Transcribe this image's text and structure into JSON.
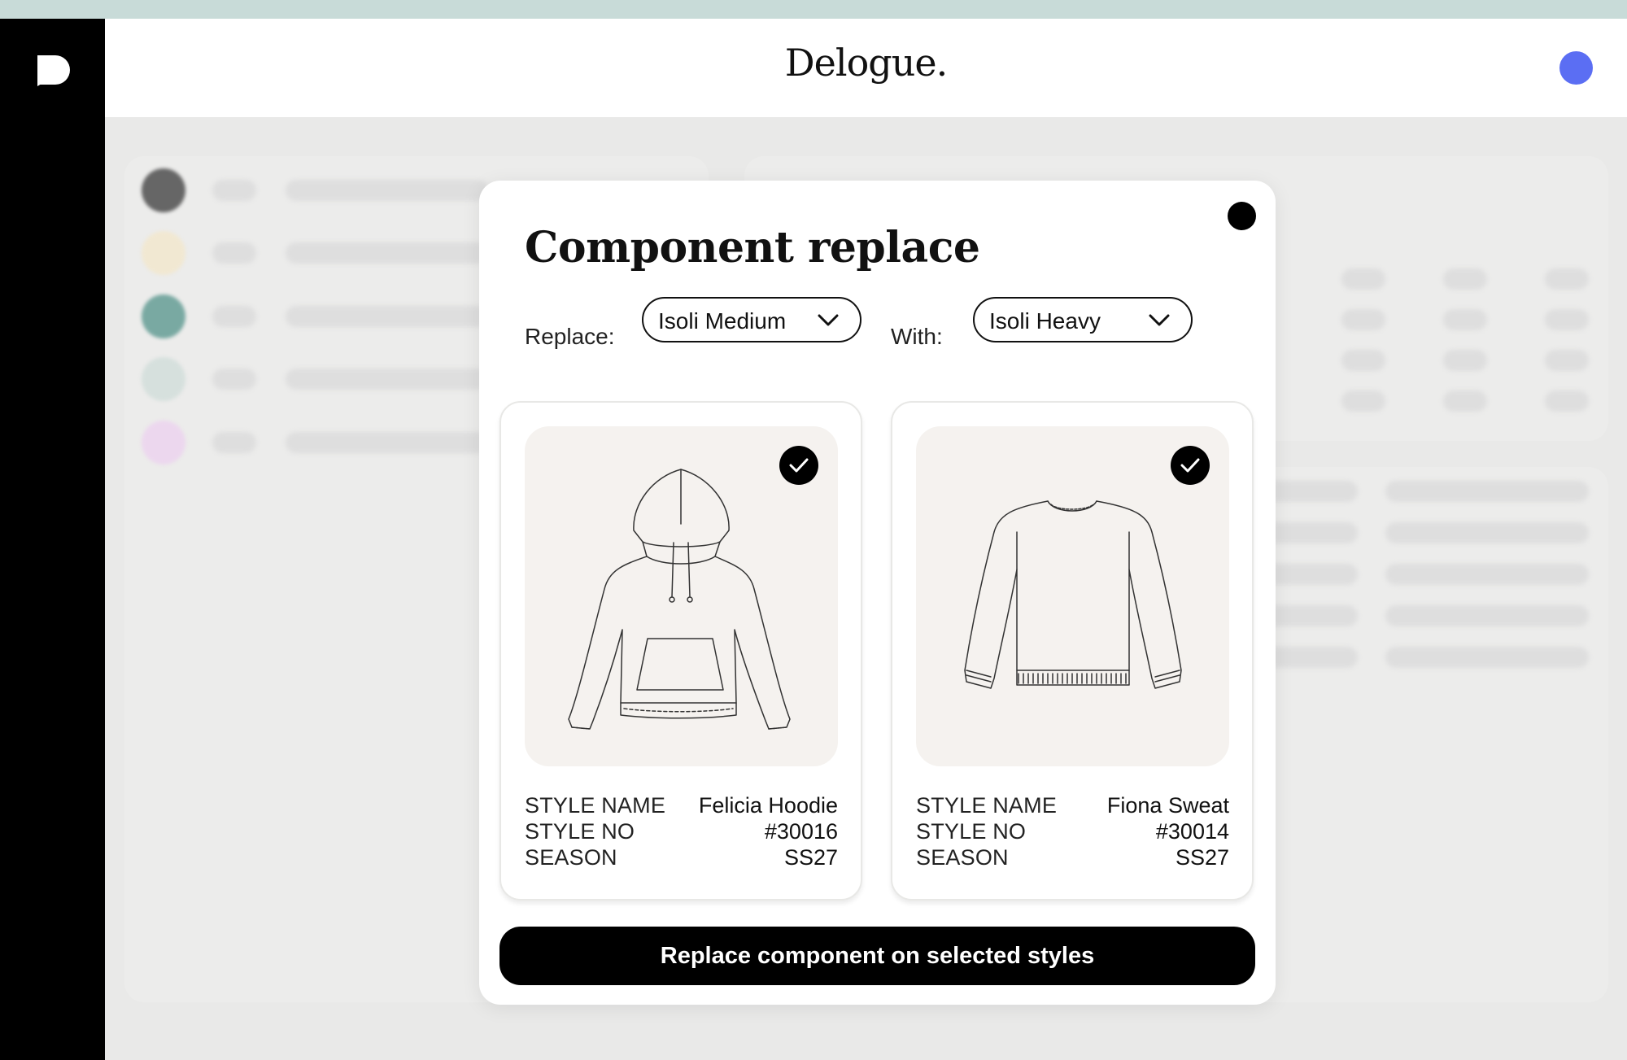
{
  "app": {
    "brand": "Delogue.",
    "accent_color": "#5b6ef3"
  },
  "modal": {
    "title": "Component replace",
    "replace_label": "Replace:",
    "replace_value": "Isoli Medium",
    "with_label": "With:",
    "with_value": "Isoli Heavy",
    "primary_button": "Replace component on selected styles"
  },
  "styles": [
    {
      "image_icon": "hoodie-icon",
      "selected": true,
      "labels": [
        "STYLE NAME",
        "STYLE NO",
        "SEASON"
      ],
      "style_name": "Felicia Hoodie",
      "style_no": "#30016",
      "season": "SS27"
    },
    {
      "image_icon": "sweatshirt-icon",
      "selected": true,
      "labels": [
        "STYLE NAME",
        "STYLE NO",
        "SEASON"
      ],
      "style_name": "Fiona Sweat",
      "style_no": "#30014",
      "season": "SS27"
    }
  ],
  "background_swatches": [
    "#666666",
    "#f1e8d2",
    "#79a9a2",
    "#d6e0dd",
    "#ecd7ee"
  ]
}
